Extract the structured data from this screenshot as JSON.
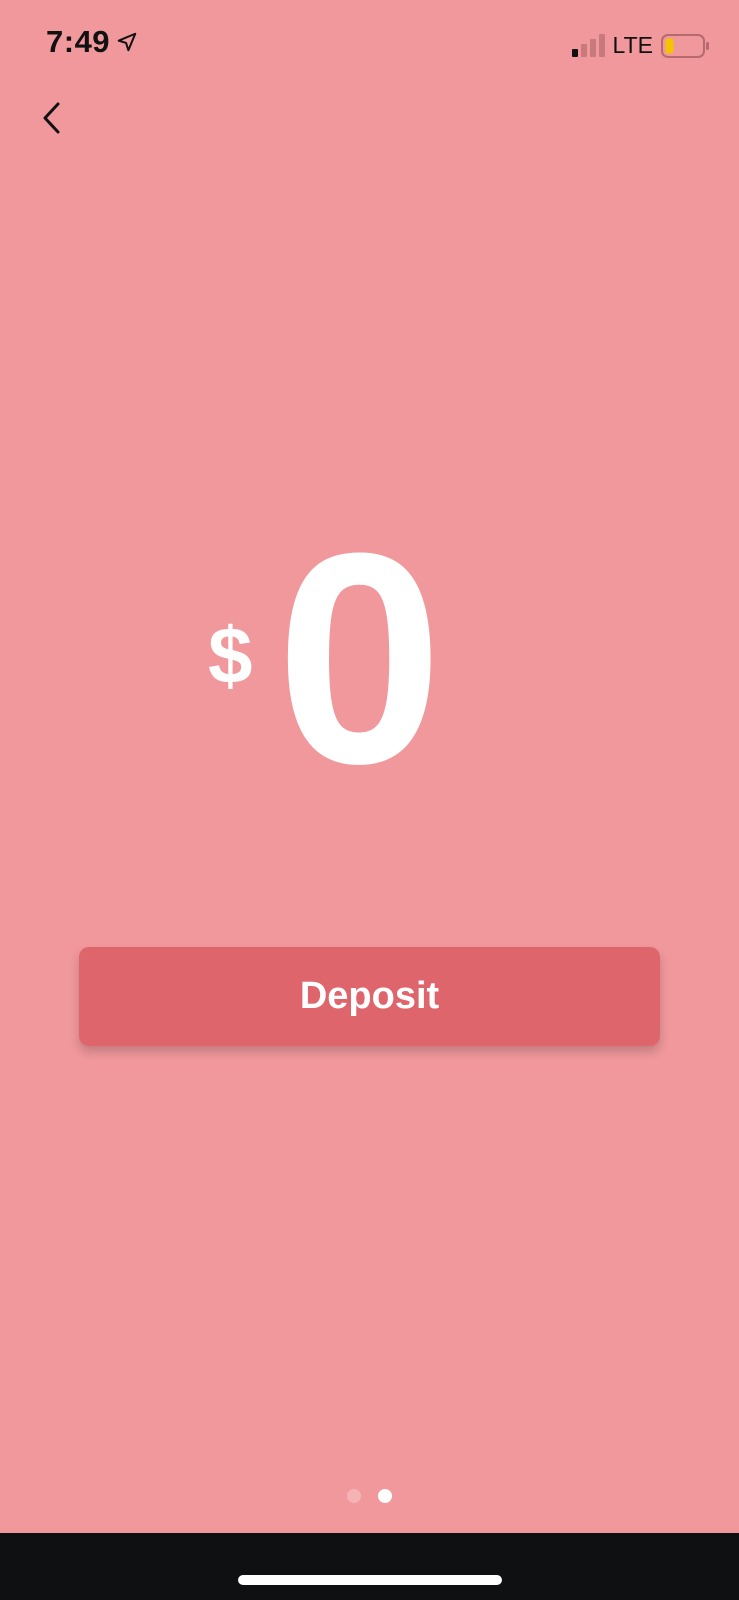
{
  "status_bar": {
    "time": "7:49",
    "network": "LTE",
    "location_icon": "location-arrow-icon",
    "signal_icon": "cellular-signal-icon",
    "battery_icon": "battery-icon"
  },
  "nav": {
    "back_icon": "chevron-left-icon"
  },
  "balance": {
    "currency": "$",
    "amount": "0"
  },
  "actions": {
    "deposit_label": "Deposit"
  },
  "pagination": {
    "total": 2,
    "current": 2
  },
  "colors": {
    "background": "#f0989b",
    "button": "#df656d",
    "text": "#ffffff",
    "battery_fill": "#f5c400"
  }
}
